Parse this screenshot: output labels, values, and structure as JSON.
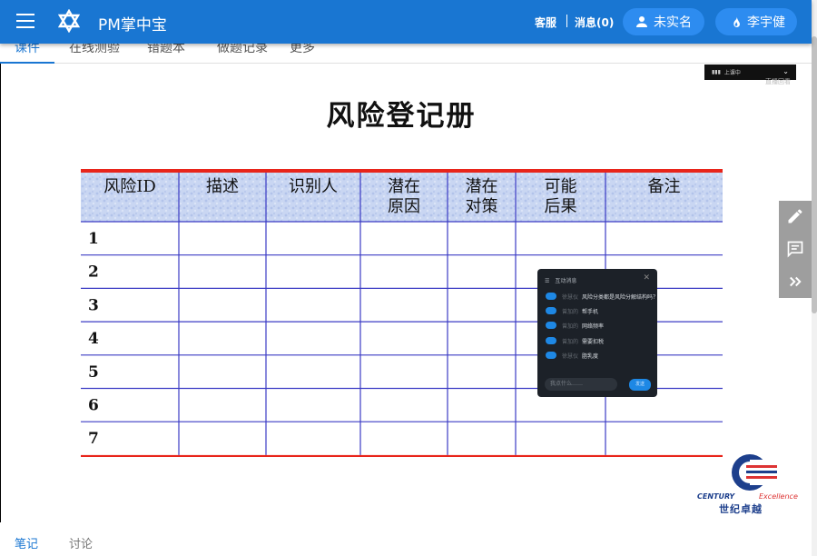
{
  "header": {
    "title": "PM掌中宝",
    "service": "客服",
    "messages": "消息(0)",
    "verify_button": "未实名",
    "user_button": "李宇健",
    "colors": {
      "bar": "#1976d2",
      "pill": "#2d8cf0"
    }
  },
  "tabs": [
    {
      "label": "课件",
      "active": true
    },
    {
      "label": "在线测验",
      "active": false
    },
    {
      "label": "错题本",
      "active": false
    },
    {
      "label": "做题记录",
      "active": false
    },
    {
      "label": "更多",
      "active": false
    }
  ],
  "slide": {
    "title": "风险登记册",
    "live_label": "上课中",
    "watermark": "直播回看",
    "columns": [
      "风险ID",
      "描述",
      "识别人",
      "潜在\n原因",
      "潜在\n对策",
      "可能\n后果",
      "备注"
    ],
    "rows": [
      "1",
      "2",
      "3",
      "4",
      "5",
      "6",
      "7"
    ],
    "logo": {
      "en_a": "CENTURY",
      "en_b": "Excellence",
      "cn": "世纪卓越"
    }
  },
  "chat": {
    "title": "互动消息",
    "messages": [
      {
        "user": "徐慧仪",
        "text": "风险分类都是风险分解结构吗？"
      },
      {
        "user": "曾加的",
        "text": "帮手机"
      },
      {
        "user": "曾加的",
        "text": "网络频率"
      },
      {
        "user": "曾加的",
        "text": "需要扣税"
      },
      {
        "user": "徐慧仪",
        "text": "脂乳度"
      }
    ],
    "input_placeholder": "我点什么……",
    "send_label": "发送"
  },
  "side_tools": [
    "pencil-icon",
    "comment-icon",
    "double-chevron-right-icon"
  ],
  "bottom_tabs": [
    {
      "label": "笔记",
      "active": true
    },
    {
      "label": "讨论",
      "active": false
    }
  ]
}
